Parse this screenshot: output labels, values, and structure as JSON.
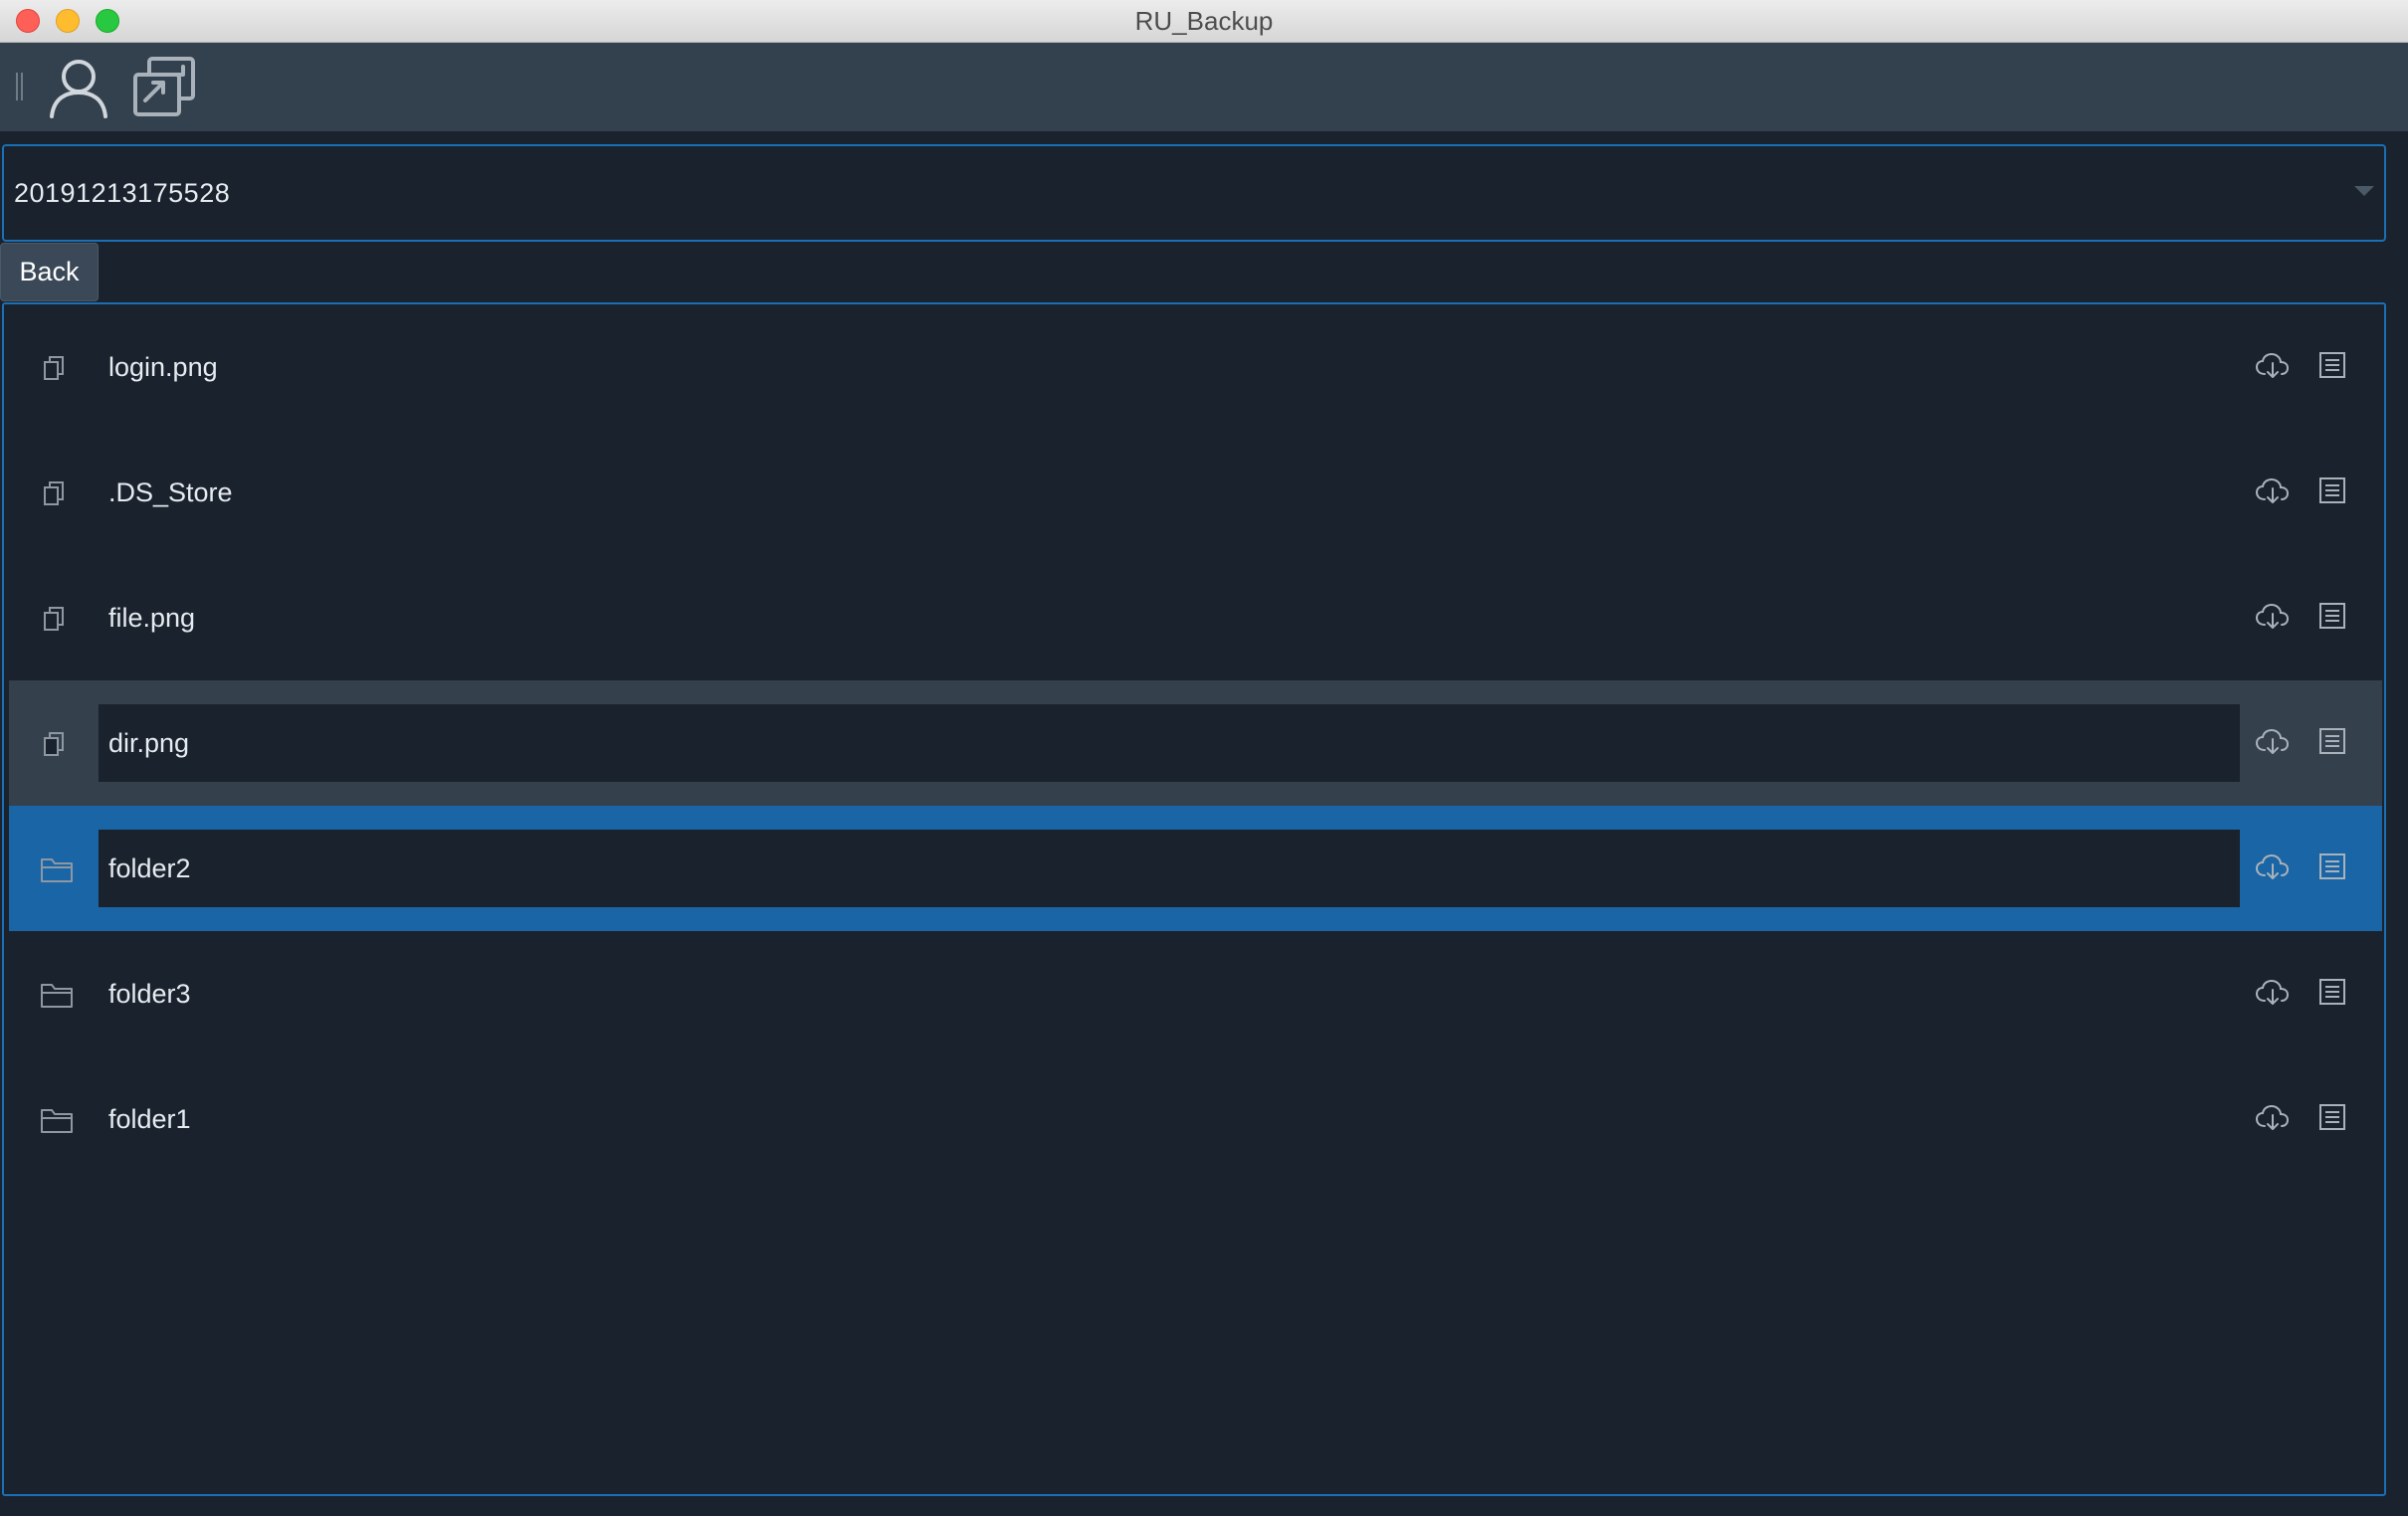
{
  "window": {
    "title": "RU_Backup"
  },
  "toolbar": {
    "buttons": [
      {
        "name": "user",
        "icon": "user-icon"
      },
      {
        "name": "sync",
        "icon": "sync-icon"
      }
    ]
  },
  "backup_select": {
    "selected": "20191213175528"
  },
  "back_button": {
    "label": "Back"
  },
  "colors": {
    "accent": "#1b6fb5",
    "background": "#1a222d",
    "toolbar": "#33414e",
    "selected_row": "#1a65a6",
    "hover_row": "#34404c"
  },
  "files": [
    {
      "name": "login.png",
      "type": "file",
      "icon": "copy-file-icon",
      "state": "normal"
    },
    {
      "name": ".DS_Store",
      "type": "file",
      "icon": "copy-file-icon",
      "state": "normal"
    },
    {
      "name": "file.png",
      "type": "file",
      "icon": "copy-file-icon",
      "state": "normal"
    },
    {
      "name": "dir.png",
      "type": "file",
      "icon": "copy-file-icon",
      "state": "hover"
    },
    {
      "name": "folder2",
      "type": "folder",
      "icon": "folder-icon",
      "state": "selected"
    },
    {
      "name": "folder3",
      "type": "folder",
      "icon": "folder-icon",
      "state": "normal"
    },
    {
      "name": "folder1",
      "type": "folder",
      "icon": "folder-icon",
      "state": "normal"
    }
  ],
  "row_actions": [
    {
      "name": "download",
      "icon": "cloud-download-icon"
    },
    {
      "name": "details",
      "icon": "list-details-icon"
    }
  ]
}
